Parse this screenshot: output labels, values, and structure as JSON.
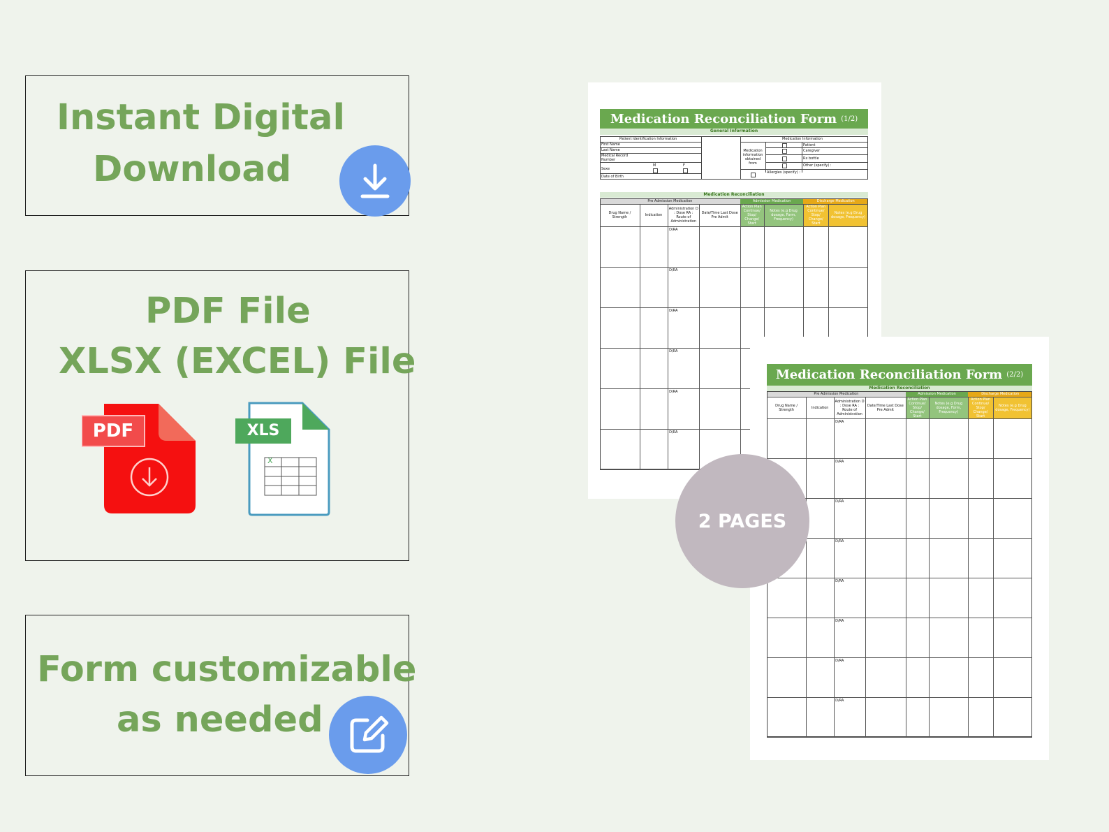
{
  "panel_download": {
    "line1": "Instant Digital",
    "line2": "Download",
    "icon": "download-icon"
  },
  "panel_files": {
    "line1": "PDF File",
    "line2": "XLSX (EXCEL) File",
    "pdf_label": "PDF",
    "xls_label": "XLS",
    "xls_cell_mark": "X"
  },
  "panel_custom": {
    "line1": "Form customizable",
    "line2": "as needed",
    "icon": "edit-icon"
  },
  "page1": {
    "title": "Medication Reconciliation Form",
    "title_suffix": "(1/2)",
    "general_info": "General Information",
    "patient_id_info": "Patient Identification Information",
    "medication_info": "Medication Information",
    "fields": [
      "First Name",
      "Last Name",
      "Medical Record Number",
      "Sexe",
      "Date of Birth"
    ],
    "sex_options": [
      "M",
      "F"
    ],
    "obtained_from": "Medication information obtained from",
    "sources": [
      "Patient",
      "Caregiver",
      "Rx bottle",
      "Other (specify) :"
    ],
    "allergies": "Allergies (specify) :",
    "med_recon": "Medication Reconciliation"
  },
  "page2": {
    "title": "Medication Reconciliation Form",
    "title_suffix": "(2/2)",
    "med_recon": "Medication Reconciliation"
  },
  "table": {
    "group_pre": "Pre Admission Medication",
    "group_admission": "Admission Medication",
    "group_discharge": "Discharge Medication",
    "col_drug": "Drug Name / Strength",
    "col_indication": "Indication",
    "col_admin": "Administration D : Dose RA : Route of Administration",
    "col_last_dose": "Date/Time Last Dose Pre Admit",
    "col_action_adm": "Action Plan Continue/ Stop/ Change/ Start",
    "col_notes_adm": "Notes (e.g Drug dosage, Form, Frequency)",
    "col_action_dis": "Action Plan Continue/ Stop/ Change/ Start",
    "col_notes_dis": "Notes (e.g Drug dosage, Frequency)",
    "row_mark": "D/RA"
  },
  "badge": {
    "text": "2 PAGES"
  },
  "colors": {
    "background": "#eff3ec",
    "green_text": "#75a55a",
    "form_green": "#6aa84f",
    "form_amber": "#f1c232",
    "icon_blue": "#6a9cec",
    "pdf_red": "#f01414",
    "badge": "#c1b8bf"
  }
}
